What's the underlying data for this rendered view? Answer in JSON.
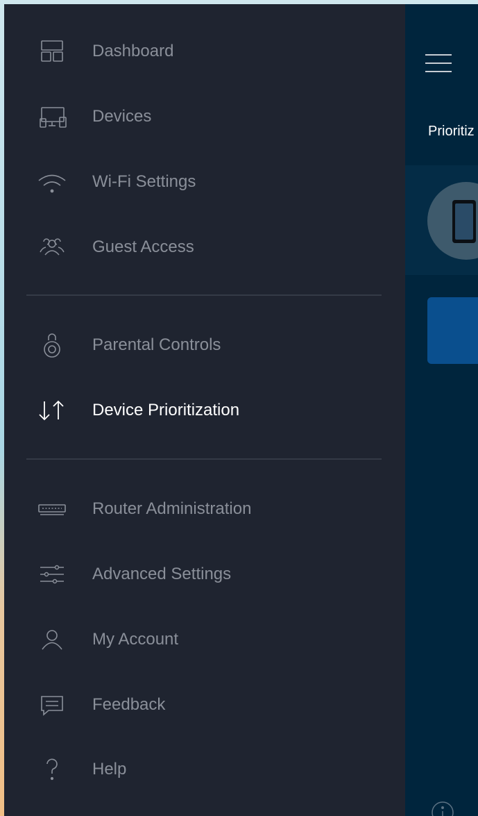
{
  "sidebar": {
    "items": [
      {
        "label": "Dashboard",
        "icon": "dashboard-icon",
        "active": false
      },
      {
        "label": "Devices",
        "icon": "devices-icon",
        "active": false
      },
      {
        "label": "Wi-Fi Settings",
        "icon": "wifi-icon",
        "active": false
      },
      {
        "label": "Guest Access",
        "icon": "guest-access-icon",
        "active": false
      },
      {
        "label": "Parental Controls",
        "icon": "parental-controls-icon",
        "active": false
      },
      {
        "label": "Device Prioritization",
        "icon": "device-prioritization-icon",
        "active": true
      },
      {
        "label": "Router Administration",
        "icon": "router-icon",
        "active": false
      },
      {
        "label": "Advanced Settings",
        "icon": "sliders-icon",
        "active": false
      },
      {
        "label": "My Account",
        "icon": "account-icon",
        "active": false
      },
      {
        "label": "Feedback",
        "icon": "feedback-icon",
        "active": false
      },
      {
        "label": "Help",
        "icon": "help-icon",
        "active": false
      }
    ]
  },
  "main": {
    "heading": "Prioritiz",
    "menu_icon": "hamburger-menu-icon",
    "device_icon": "tablet-icon",
    "footer_icon": "info-icon"
  },
  "colors": {
    "sidebar_bg": "#1f2430",
    "main_bg": "#00253d",
    "active_text": "#ffffff",
    "inactive_text": "#8a8f99",
    "accent_button": "#0a4f8e"
  }
}
